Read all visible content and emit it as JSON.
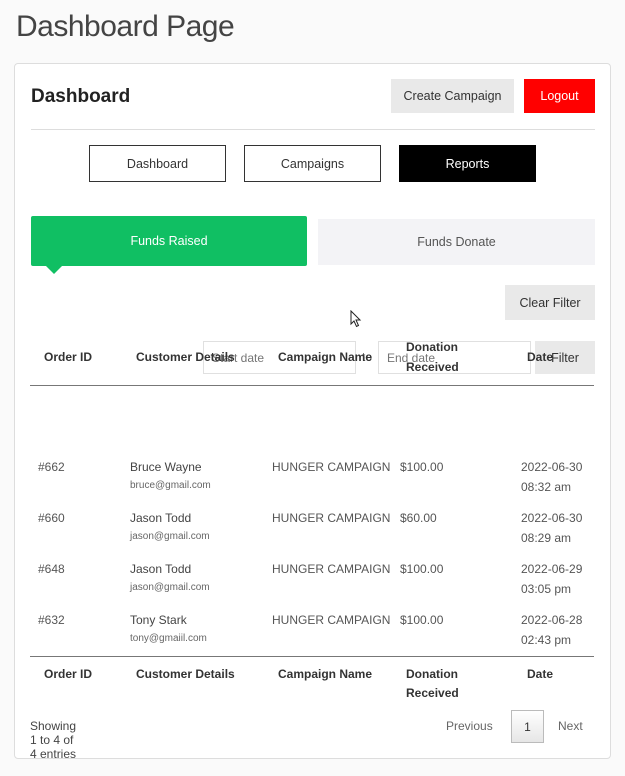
{
  "page_title": "Dashboard Page",
  "header": {
    "title": "Dashboard",
    "create_label": "Create Campaign",
    "logout_label": "Logout"
  },
  "nav": {
    "dashboard": "Dashboard",
    "campaigns": "Campaigns",
    "reports": "Reports"
  },
  "tabs": {
    "raised": "Funds Raised",
    "donate": "Funds Donate"
  },
  "filter": {
    "clear_label": "Clear Filter",
    "start_placeholder": "Start date",
    "to_label": "to",
    "end_placeholder": "End date",
    "filter_label": "Filter"
  },
  "table": {
    "headers": {
      "order_id": "Order ID",
      "customer": "Customer Details",
      "campaign": "Campaign Name",
      "donation_1": "Donation",
      "donation_2": "Received",
      "date": "Date"
    },
    "rows": [
      {
        "order_id": "#662",
        "name": "Bruce Wayne",
        "email": "bruce@gmail.com",
        "campaign": "HUNGER CAMPAIGN",
        "amount": "$100.00",
        "date": "2022-06-30",
        "time": "08:32 am"
      },
      {
        "order_id": "#660",
        "name": "Jason Todd",
        "email": "jason@gmail.com",
        "campaign": "HUNGER CAMPAIGN",
        "amount": "$60.00",
        "date": "2022-06-30",
        "time": "08:29 am"
      },
      {
        "order_id": "#648",
        "name": "Jason Todd",
        "email": "jason@gmail.com",
        "campaign": "HUNGER CAMPAIGN",
        "amount": "$100.00",
        "date": "2022-06-29",
        "time": "03:05 pm"
      },
      {
        "order_id": "#632",
        "name": "Tony Stark",
        "email": "tony@gmaiil.com",
        "campaign": "HUNGER CAMPAIGN",
        "amount": "$100.00",
        "date": "2022-06-28",
        "time": "02:43 pm"
      }
    ]
  },
  "footer": {
    "showing": "Showing 1 to 4 of 4 entries",
    "previous": "Previous",
    "current_page": "1",
    "next": "Next"
  },
  "colors": {
    "accent_green": "#10bf63",
    "logout_red": "#ff0000"
  }
}
